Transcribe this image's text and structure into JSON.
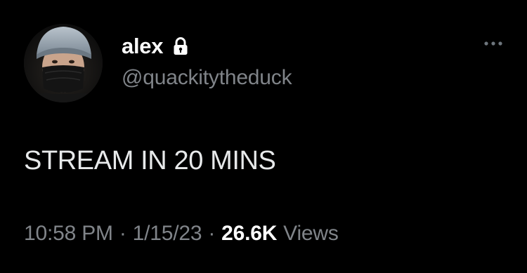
{
  "tweet": {
    "author": {
      "display_name": "alex",
      "handle": "@quackitytheduck",
      "avatar_icon": "profile-photo",
      "lock_icon": "lock-icon"
    },
    "text": "STREAM IN 20 MINS",
    "time": "10:58 PM",
    "separator": "·",
    "date": "1/15/23",
    "views_count": "26.6K",
    "views_label": "Views",
    "more_icon": "more-icon"
  },
  "colors": {
    "background": "#000000",
    "primary_text": "#e7e9ea",
    "secondary_text": "#808489",
    "name_text": "#ffffff"
  }
}
